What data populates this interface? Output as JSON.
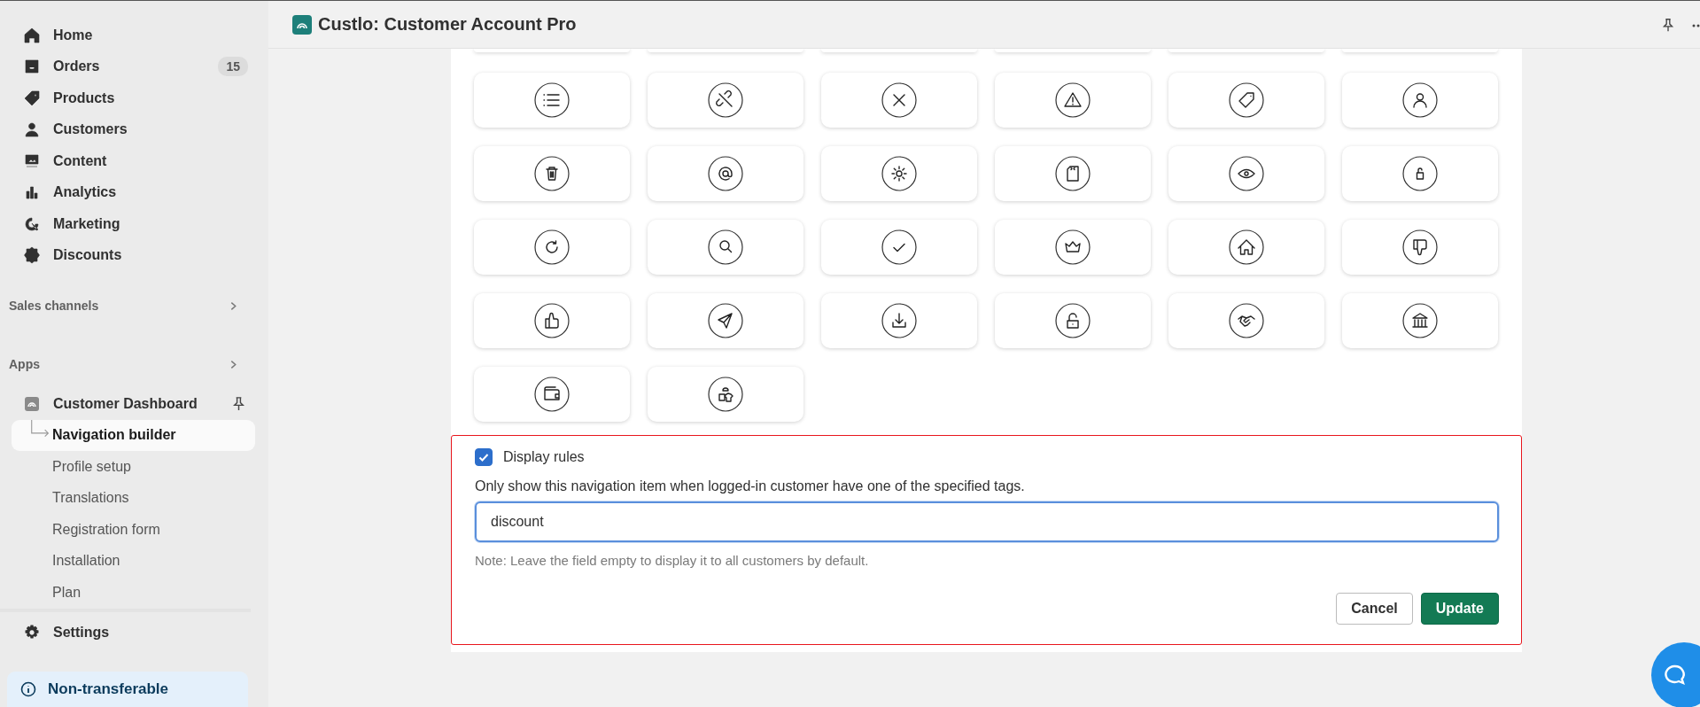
{
  "header": {
    "title": "Custlo: Customer Account Pro"
  },
  "sidebar": {
    "nav": [
      {
        "label": "Home"
      },
      {
        "label": "Orders",
        "badge": "15"
      },
      {
        "label": "Products"
      },
      {
        "label": "Customers"
      },
      {
        "label": "Content"
      },
      {
        "label": "Analytics"
      },
      {
        "label": "Marketing"
      },
      {
        "label": "Discounts"
      }
    ],
    "sections": [
      {
        "label": "Sales channels"
      },
      {
        "label": "Apps"
      }
    ],
    "app": {
      "name": "Customer Dashboard",
      "pages": [
        {
          "label": "Navigation builder",
          "selected": true
        },
        {
          "label": "Profile setup",
          "selected": false
        },
        {
          "label": "Translations",
          "selected": false
        },
        {
          "label": "Registration form",
          "selected": false
        },
        {
          "label": "Installation",
          "selected": false
        },
        {
          "label": "Plan",
          "selected": false
        }
      ]
    },
    "settings": {
      "label": "Settings"
    },
    "notice": {
      "label": "Non-transferable"
    }
  },
  "display_rules": {
    "checked": true,
    "label": "Display rules",
    "description": "Only show this navigation item when logged-in customer have one of the specified tags.",
    "tags_field": {
      "value": "discount"
    },
    "note": "Note: Leave the field empty to display it to all customers by default.",
    "buttons": [
      {
        "label": "Cancel",
        "kind": "secondary"
      },
      {
        "label": "Update",
        "kind": "primary"
      }
    ]
  }
}
